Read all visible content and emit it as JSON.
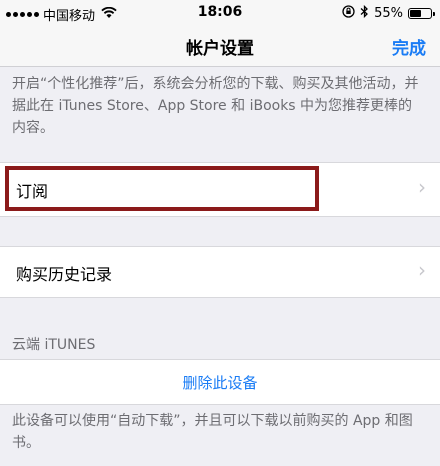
{
  "status_bar": {
    "carrier": "中国移动",
    "time": "18:06",
    "battery_percent": "55%",
    "battery_level": 0.55,
    "icons": [
      "wifi-icon",
      "orientation-lock-icon",
      "bluetooth-icon",
      "battery-icon"
    ]
  },
  "nav": {
    "title": "帐户设置",
    "done_label": "完成",
    "accent_color": "#1a7cf5"
  },
  "intro_text": "开启“个性化推荐”后，系统会分析您的下载、购买及其他活动，并据此在 iTunes Store、App Store 和 iBooks 中为您推荐更棒的内容。",
  "items": {
    "subscriptions": "订阅",
    "purchase_history": "购买历史记录"
  },
  "cloud_section": {
    "header": "云端 iTUNES",
    "remove_device": "删除此设备",
    "footer": "此设备可以使用“自动下载”，并且可以下载以前购买的 App 和图书。"
  },
  "highlight_color": "#8b1a1a"
}
